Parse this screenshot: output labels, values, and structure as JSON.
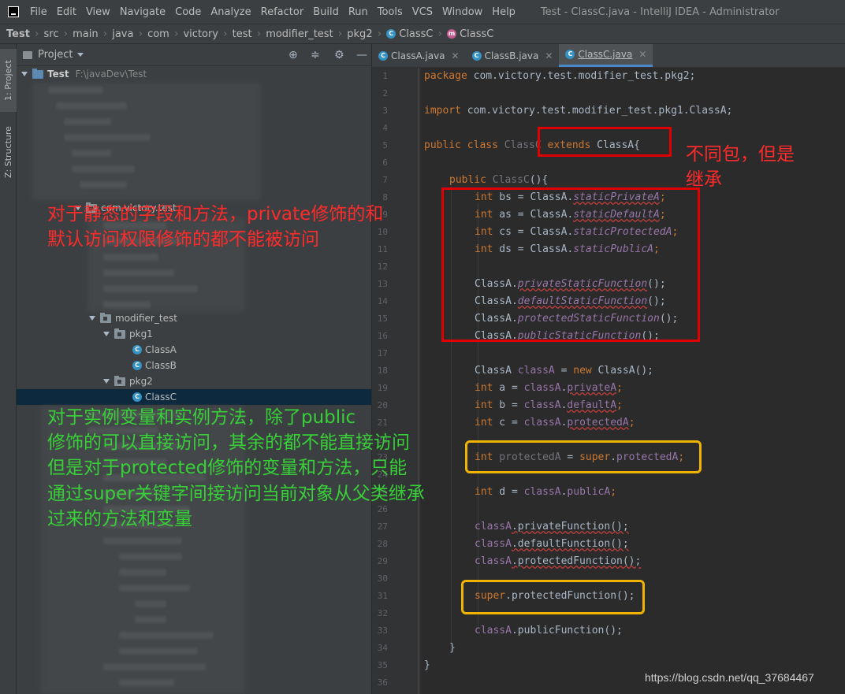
{
  "menubar": {
    "items": [
      "File",
      "Edit",
      "View",
      "Navigate",
      "Code",
      "Analyze",
      "Refactor",
      "Build",
      "Run",
      "Tools",
      "VCS",
      "Window",
      "Help"
    ],
    "window_title": "Test - ClassC.java - IntelliJ IDEA - Administrator"
  },
  "breadcrumb": [
    "Test",
    "src",
    "main",
    "java",
    "com",
    "victory",
    "test",
    "modifier_test",
    "pkg2",
    "ClassC",
    "ClassC"
  ],
  "side_tabs": {
    "project": "1: Project",
    "structure": "Z: Structure"
  },
  "project_panel": {
    "title": "Project",
    "tree": [
      {
        "label": "Test",
        "path": "F:\\javaDev\\Test"
      },
      {
        "label": "com.victory.test"
      },
      {
        "label": "modifier_test"
      },
      {
        "label": "pkg1"
      },
      {
        "label": "ClassA"
      },
      {
        "label": "ClassB"
      },
      {
        "label": "pkg2"
      },
      {
        "label": "ClassC"
      }
    ]
  },
  "editor_tabs": [
    "ClassA.java",
    "ClassB.java",
    "ClassC.java"
  ],
  "line_numbers": [
    "1",
    "2",
    "3",
    "4",
    "5",
    "6",
    "7",
    "8",
    "9",
    "10",
    "11",
    "12",
    "13",
    "14",
    "15",
    "16",
    "17",
    "18",
    "19",
    "20",
    "21",
    "22",
    "23",
    "24",
    "25",
    "26",
    "27",
    "28",
    "29",
    "30",
    "31",
    "32",
    "33",
    "34",
    "35",
    "36"
  ],
  "code": {
    "l1": [
      "package",
      " com.victory.test.modifier_test.pkg2;"
    ],
    "l3": [
      "import",
      " com.victory.test.modifier_test.pkg1.ClassA;"
    ],
    "l5": [
      "public class",
      " ClassC",
      " extends",
      " ClassA{"
    ],
    "l7": [
      "public",
      " ClassC",
      "(){"
    ],
    "l8": [
      "int",
      " bs = ClassA.",
      "staticPrivateA",
      ";"
    ],
    "l9": [
      "int",
      " as = ClassA.",
      "staticDefaultA",
      ";"
    ],
    "l10": [
      "int",
      " cs = ClassA.",
      "staticProtectedA",
      ";"
    ],
    "l11": [
      "int",
      " ds = ClassA.",
      "staticPublicA",
      ";"
    ],
    "l13": [
      "ClassA.",
      "privateStaticFunction",
      "();"
    ],
    "l14": [
      "ClassA.",
      "defaultStaticFunction",
      "();"
    ],
    "l15": [
      "ClassA.",
      "protectedStaticFunction",
      "();"
    ],
    "l16": [
      "ClassA.",
      "publicStaticFunction",
      "();"
    ],
    "l18": [
      "ClassA ",
      "classA",
      " = ",
      "new",
      " ClassA();"
    ],
    "l19": [
      "int",
      " a = ",
      "classA",
      ".",
      "privateA",
      ";"
    ],
    "l20": [
      "int",
      " b = ",
      "classA",
      ".",
      "defaultA",
      ";"
    ],
    "l21": [
      "int",
      " c = ",
      "classA",
      ".",
      "protectedA",
      ";"
    ],
    "l23": [
      "int",
      " protectedA",
      " = ",
      "super",
      ".",
      "protectedA",
      ";"
    ],
    "l25": [
      "int",
      " d = ",
      "classA",
      ".",
      "publicA",
      ";"
    ],
    "l27": [
      "classA",
      ".privateFunction();"
    ],
    "l28": [
      "classA",
      ".defaultFunction();"
    ],
    "l29": [
      "classA",
      ".protectedFunction();"
    ],
    "l31": [
      "super",
      ".protectedFunction();"
    ],
    "l33": [
      "classA",
      ".publicFunction();"
    ],
    "l34": "}",
    "l35": "}"
  },
  "annotations": {
    "inherit_note_1": "不同包，但是",
    "inherit_note_2": "继承",
    "static_note_1": "对于静态的字段和方法，private修饰的和",
    "static_note_2": "默认访问权限修饰的都不能被访问",
    "instance_note_1": "对于实例变量和实例方法，除了public",
    "instance_note_2": "修饰的可以直接访问，其余的都不能直接访问",
    "instance_note_3": "但是对于protected修饰的变量和方法，只能",
    "instance_note_4": "通过super关键字间接访问当前对象从父类继承",
    "instance_note_5": "过来的方法和变量"
  },
  "watermark": "https://blog.csdn.net/qq_37684467"
}
